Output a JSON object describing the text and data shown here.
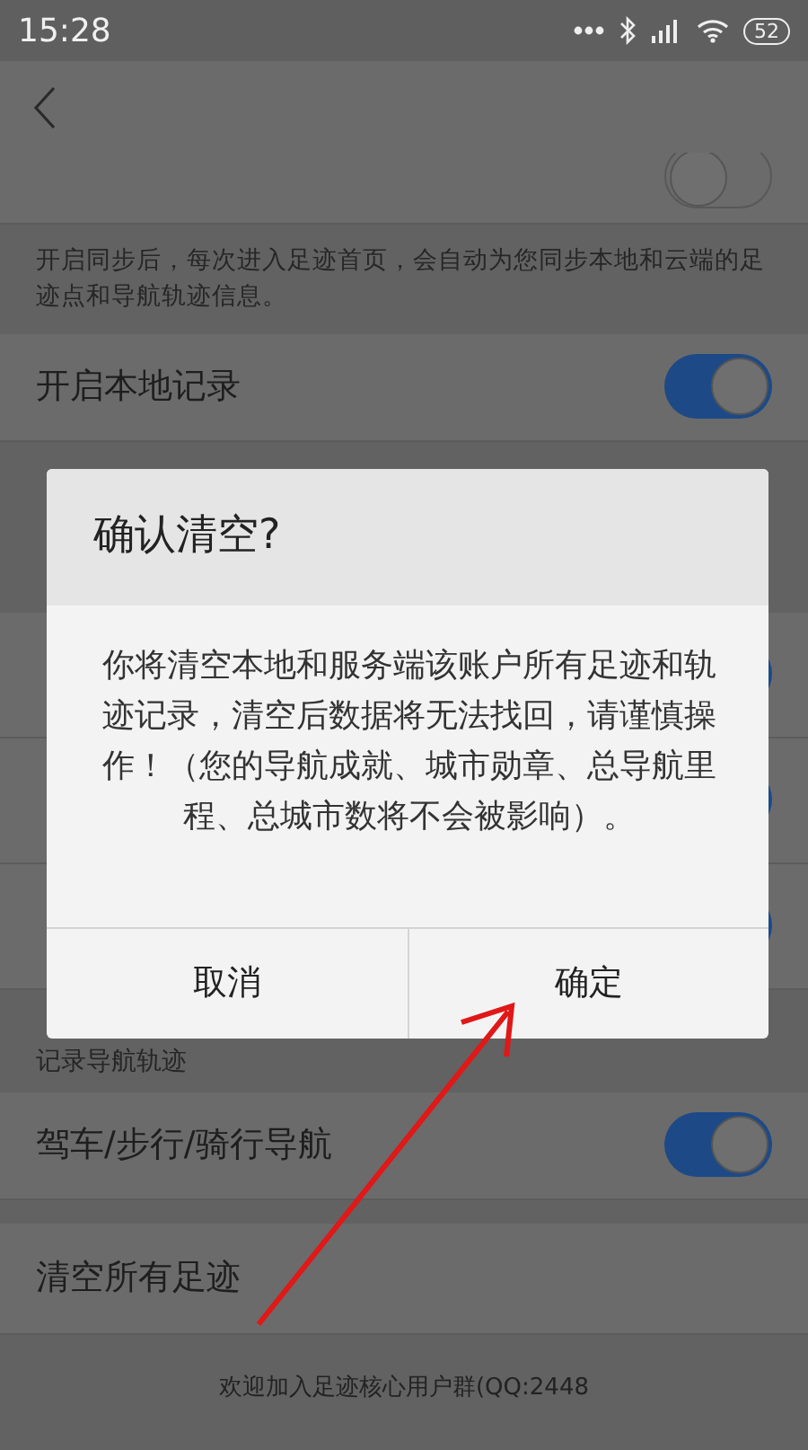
{
  "status_bar": {
    "time": "15:28",
    "battery": "52"
  },
  "settings": [
    {
      "kind": "toggle",
      "on": false
    },
    {
      "kind": "note",
      "text": "开启同步后，每次进入足迹首页，会自动为您同步本地和云端的足迹点和导航轨迹信息。"
    },
    {
      "kind": "toggle",
      "label": "开启本地记录",
      "on": true
    },
    {
      "kind": "spacer"
    },
    {
      "kind": "toggle",
      "on": true
    },
    {
      "kind": "toggle",
      "on": true
    },
    {
      "kind": "toggle",
      "on": true
    },
    {
      "kind": "section",
      "text": "记录导航轨迹"
    },
    {
      "kind": "toggle",
      "label": "驾车/步行/骑行导航",
      "on": true
    },
    {
      "kind": "gap"
    },
    {
      "kind": "action",
      "label": "清空所有足迹"
    }
  ],
  "footer": "欢迎加入足迹核心用户群(QQ:2448",
  "dialog": {
    "title": "确认清空?",
    "message": "你将清空本地和服务端该账户所有足迹和轨迹记录，清空后数据将无法找回，请谨慎操作！（您的导航成就、城市勋章、总导航里程、总城市数将不会被影响）。",
    "buttons": [
      "取消",
      "确定"
    ]
  }
}
